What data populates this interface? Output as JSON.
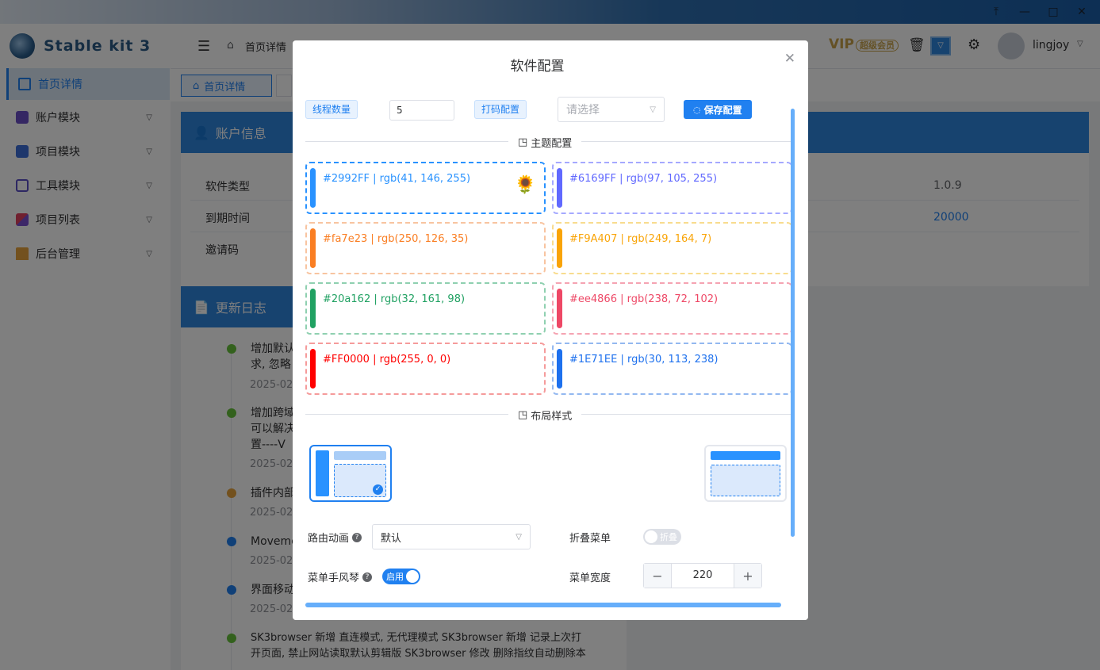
{
  "window": {
    "pin_icon": "pin-top-icon",
    "minimize": "minimize-icon",
    "maximize": "maximize-icon",
    "close": "close-icon"
  },
  "app": {
    "name": "Stable kit 3"
  },
  "sidebar": {
    "items": [
      {
        "label": "首页详情",
        "icon": "home-icon",
        "active": true
      },
      {
        "label": "账户模块",
        "icon": "account-icon"
      },
      {
        "label": "项目模块",
        "icon": "layers-icon"
      },
      {
        "label": "工具模块",
        "icon": "toolbox-icon"
      },
      {
        "label": "项目列表",
        "icon": "grid-icon"
      },
      {
        "label": "后台管理",
        "icon": "crown-icon"
      }
    ]
  },
  "header": {
    "breadcrumb": "首页详情",
    "vip": "VIP",
    "vip_sub": "超级会员",
    "username": "lingjoy"
  },
  "tabs": [
    {
      "label": "首页详情"
    }
  ],
  "account_card": {
    "title": "账户信息",
    "rows": [
      {
        "label": "软件类型",
        "value": "1.0.9"
      },
      {
        "label": "到期时间",
        "value": "20000"
      },
      {
        "label": "邀请码",
        "value": ""
      }
    ]
  },
  "log_card": {
    "title": "更新日志",
    "entries": [
      {
        "lines": [
          "增加默认",
          "求, 忽略"
        ],
        "date": "2025-02-",
        "color": "#67c23a"
      },
      {
        "lines": [
          "增加跨域",
          "可以解决",
          "置----V"
        ],
        "date": "2025-02-",
        "color": "#67c23a"
      },
      {
        "lines": [
          "插件内部"
        ],
        "date": "2025-02-",
        "color": "#e6a23c"
      },
      {
        "lines": [
          "Moveme"
        ],
        "date": "2025-02-",
        "color": "#2080f0"
      },
      {
        "lines": [
          "界面移动"
        ],
        "date": "2025-02-",
        "color": "#2080f0"
      },
      {
        "lines": [
          "SK3browser 新增 直连模式, 无代理模式 SK3browser 新增 记录上次打",
          "开页面, 禁止网站读取默认剪辑版 SK3browser 修改 删除指纹自动删除本"
        ],
        "date": "",
        "color": "#67c23a"
      }
    ]
  },
  "modal": {
    "title": "软件配置",
    "thread_label": "线程数量",
    "thread_value": "5",
    "captcha_label": "打码配置",
    "captcha_placeholder": "请选择",
    "save_label": "保存配置",
    "theme_section": "主题配置",
    "layout_section": "布局样式",
    "themes": [
      {
        "text": "#2992FF | rgb(41, 146, 255)",
        "color": "#2992FF",
        "selected": true
      },
      {
        "text": "#6169FF | rgb(97, 105, 255)",
        "color": "#6169FF"
      },
      {
        "text": "#fa7e23 | rgb(250, 126, 35)",
        "color": "#fa7e23"
      },
      {
        "text": "#F9A407 | rgb(249, 164, 7)",
        "color": "#F9A407"
      },
      {
        "text": "#20a162 | rgb(32, 161, 98)",
        "color": "#20a162"
      },
      {
        "text": "#ee4866 | rgb(238, 72, 102)",
        "color": "#ee4866"
      },
      {
        "text": "#FF0000 | rgb(255, 0, 0)",
        "color": "#FF0000"
      },
      {
        "text": "#1E71EE | rgb(30, 113, 238)",
        "color": "#1E71EE"
      }
    ],
    "route_anim_label": "路由动画",
    "route_anim_value": "默认",
    "collapse_label": "折叠菜单",
    "collapse_switch": "折叠",
    "accordion_label": "菜单手风琴",
    "accordion_switch": "启用",
    "menu_width_label": "菜单宽度",
    "menu_width_value": "220"
  }
}
